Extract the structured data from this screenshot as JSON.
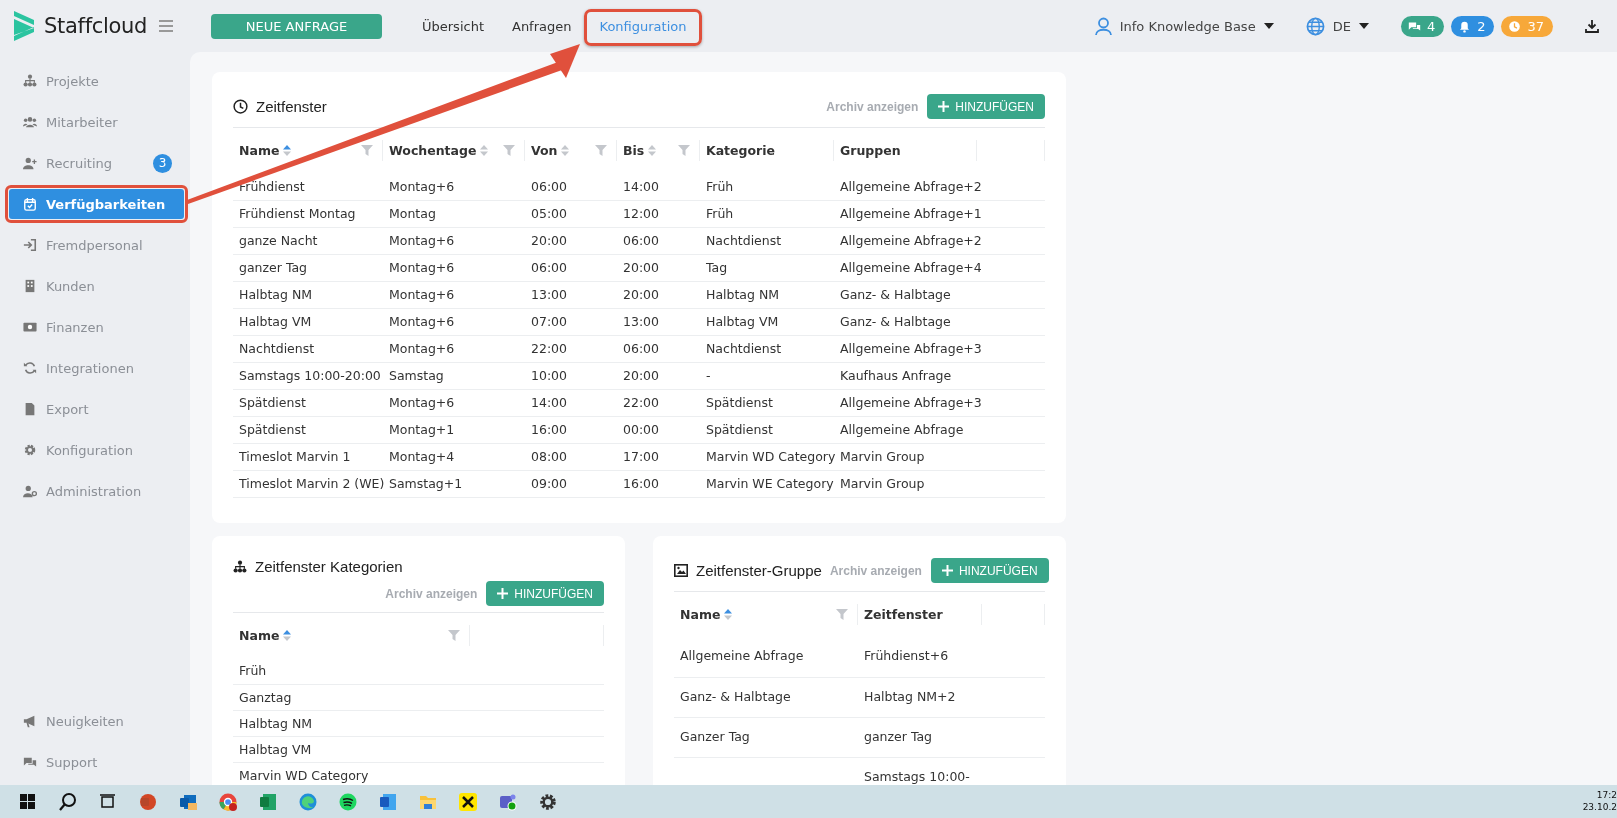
{
  "brand": {
    "name": "Staffcloud"
  },
  "topbar": {
    "primary_button": "NEUE ANFRAGE",
    "tabs": [
      {
        "label": "Übersicht",
        "selected": false
      },
      {
        "label": "Anfragen",
        "selected": false
      },
      {
        "label": "Konfiguration",
        "selected": true
      }
    ],
    "user": "Info Knowledge Base",
    "language": "DE",
    "counters": [
      {
        "kind": "chat",
        "count": "4",
        "color": "#3aa68a"
      },
      {
        "kind": "bell",
        "count": "2",
        "color": "#2f8fe0"
      },
      {
        "kind": "clock",
        "count": "37",
        "color": "#f7a83a"
      }
    ]
  },
  "sidebar": {
    "items": [
      {
        "kind": "projects",
        "label": "Projekte",
        "selected": false
      },
      {
        "kind": "people",
        "label": "Mitarbeiter",
        "selected": false
      },
      {
        "kind": "recruit",
        "label": "Recruiting",
        "selected": false,
        "badge": "3"
      },
      {
        "kind": "calendar",
        "label": "Verfügbarkeiten",
        "selected": true
      },
      {
        "kind": "signin",
        "label": "Fremdpersonal",
        "selected": false
      },
      {
        "kind": "building",
        "label": "Kunden",
        "selected": false
      },
      {
        "kind": "money",
        "label": "Finanzen",
        "selected": false
      },
      {
        "kind": "sync",
        "label": "Integrationen",
        "selected": false
      },
      {
        "kind": "file",
        "label": "Export",
        "selected": false
      },
      {
        "kind": "gear",
        "label": "Konfiguration",
        "selected": false
      },
      {
        "kind": "admin",
        "label": "Administration",
        "selected": false
      }
    ],
    "bottom_items": [
      {
        "kind": "megaphone",
        "label": "Neuigkeiten"
      },
      {
        "kind": "chat",
        "label": "Support"
      }
    ]
  },
  "cards": [
    {
      "kind": "timeslots",
      "title": "Zeitfenster",
      "archive_link": "Archiv anzeigen",
      "add_button": "HINZUFÜGEN",
      "columns": [
        {
          "label": "Name",
          "sorted": true,
          "filter": true
        },
        {
          "label": "Wochentage",
          "sorted": false,
          "filter": true
        },
        {
          "label": "Von",
          "sorted": false,
          "filter": true
        },
        {
          "label": "Bis",
          "sorted": false,
          "filter": true
        },
        {
          "label": "Kategorie"
        },
        {
          "label": "Gruppen"
        }
      ],
      "rows": [
        [
          "Frühdienst",
          "Montag+6",
          "06:00",
          "14:00",
          "Früh",
          "Allgemeine Abfrage+2"
        ],
        [
          "Frühdienst Montag",
          "Montag",
          "05:00",
          "12:00",
          "Früh",
          "Allgemeine Abfrage+1"
        ],
        [
          "ganze Nacht",
          "Montag+6",
          "20:00",
          "06:00",
          "Nachtdienst",
          "Allgemeine Abfrage+2"
        ],
        [
          "ganzer Tag",
          "Montag+6",
          "06:00",
          "20:00",
          "Tag",
          "Allgemeine Abfrage+4"
        ],
        [
          "Halbtag NM",
          "Montag+6",
          "13:00",
          "20:00",
          "Halbtag NM",
          "Ganz- & Halbtage"
        ],
        [
          "Halbtag VM",
          "Montag+6",
          "07:00",
          "13:00",
          "Halbtag VM",
          "Ganz- & Halbtage"
        ],
        [
          "Nachtdienst",
          "Montag+6",
          "22:00",
          "06:00",
          "Nachtdienst",
          "Allgemeine Abfrage+3"
        ],
        [
          "Samstags 10:00-20:00",
          "Samstag",
          "10:00",
          "20:00",
          "-",
          "Kaufhaus Anfrage"
        ],
        [
          "Spätdienst",
          "Montag+6",
          "14:00",
          "22:00",
          "Spätdienst",
          "Allgemeine Abfrage+3"
        ],
        [
          "Spätdienst",
          "Montag+1",
          "16:00",
          "00:00",
          "Spätdienst",
          "Allgemeine Abfrage"
        ],
        [
          "Timeslot Marvin 1",
          "Montag+4",
          "08:00",
          "17:00",
          "Marvin WD Category",
          "Marvin Group"
        ],
        [
          "Timeslot Marvin 2 (WE)",
          "Samstag+1",
          "09:00",
          "16:00",
          "Marvin WE Category",
          "Marvin Group"
        ]
      ]
    },
    {
      "kind": "categories",
      "title": "Zeitfenster Kategorien",
      "archive_link": "Archiv anzeigen",
      "add_button": "HINZUFÜGEN",
      "columns": [
        {
          "label": "Name",
          "sorted": true,
          "filter": true
        }
      ],
      "rows": [
        [
          "Früh"
        ],
        [
          "Ganztag"
        ],
        [
          "Halbtag NM"
        ],
        [
          "Halbtag VM"
        ],
        [
          "Marvin WD Category"
        ]
      ]
    },
    {
      "kind": "groups",
      "title": "Zeitfenster-Gruppe",
      "archive_link": "Archiv anzeigen",
      "add_button": "HINZUFÜGEN",
      "columns": [
        {
          "label": "Name",
          "sorted": true,
          "filter": true
        },
        {
          "label": "Zeitfenster"
        }
      ],
      "rows": [
        [
          "Allgemeine Abfrage",
          "Frühdienst+6"
        ],
        [
          "Ganz- & Halbtage",
          "Halbtag NM+2"
        ],
        [
          "Ganzer Tag",
          "ganzer Tag"
        ],
        [
          "",
          "Samstags 10:00-"
        ]
      ]
    }
  ],
  "taskbar": {
    "apps": [
      {
        "kind": "windows"
      },
      {
        "kind": "search"
      },
      {
        "kind": "taskview"
      },
      {
        "kind": "powerpoint"
      },
      {
        "kind": "outlook"
      },
      {
        "kind": "chrome"
      },
      {
        "kind": "excel"
      },
      {
        "kind": "edge"
      },
      {
        "kind": "spotify"
      },
      {
        "kind": "word"
      },
      {
        "kind": "folder"
      },
      {
        "kind": "raiffeisen"
      },
      {
        "kind": "teams"
      },
      {
        "kind": "gear"
      }
    ],
    "time": "17:2",
    "date": "23.10.2"
  }
}
